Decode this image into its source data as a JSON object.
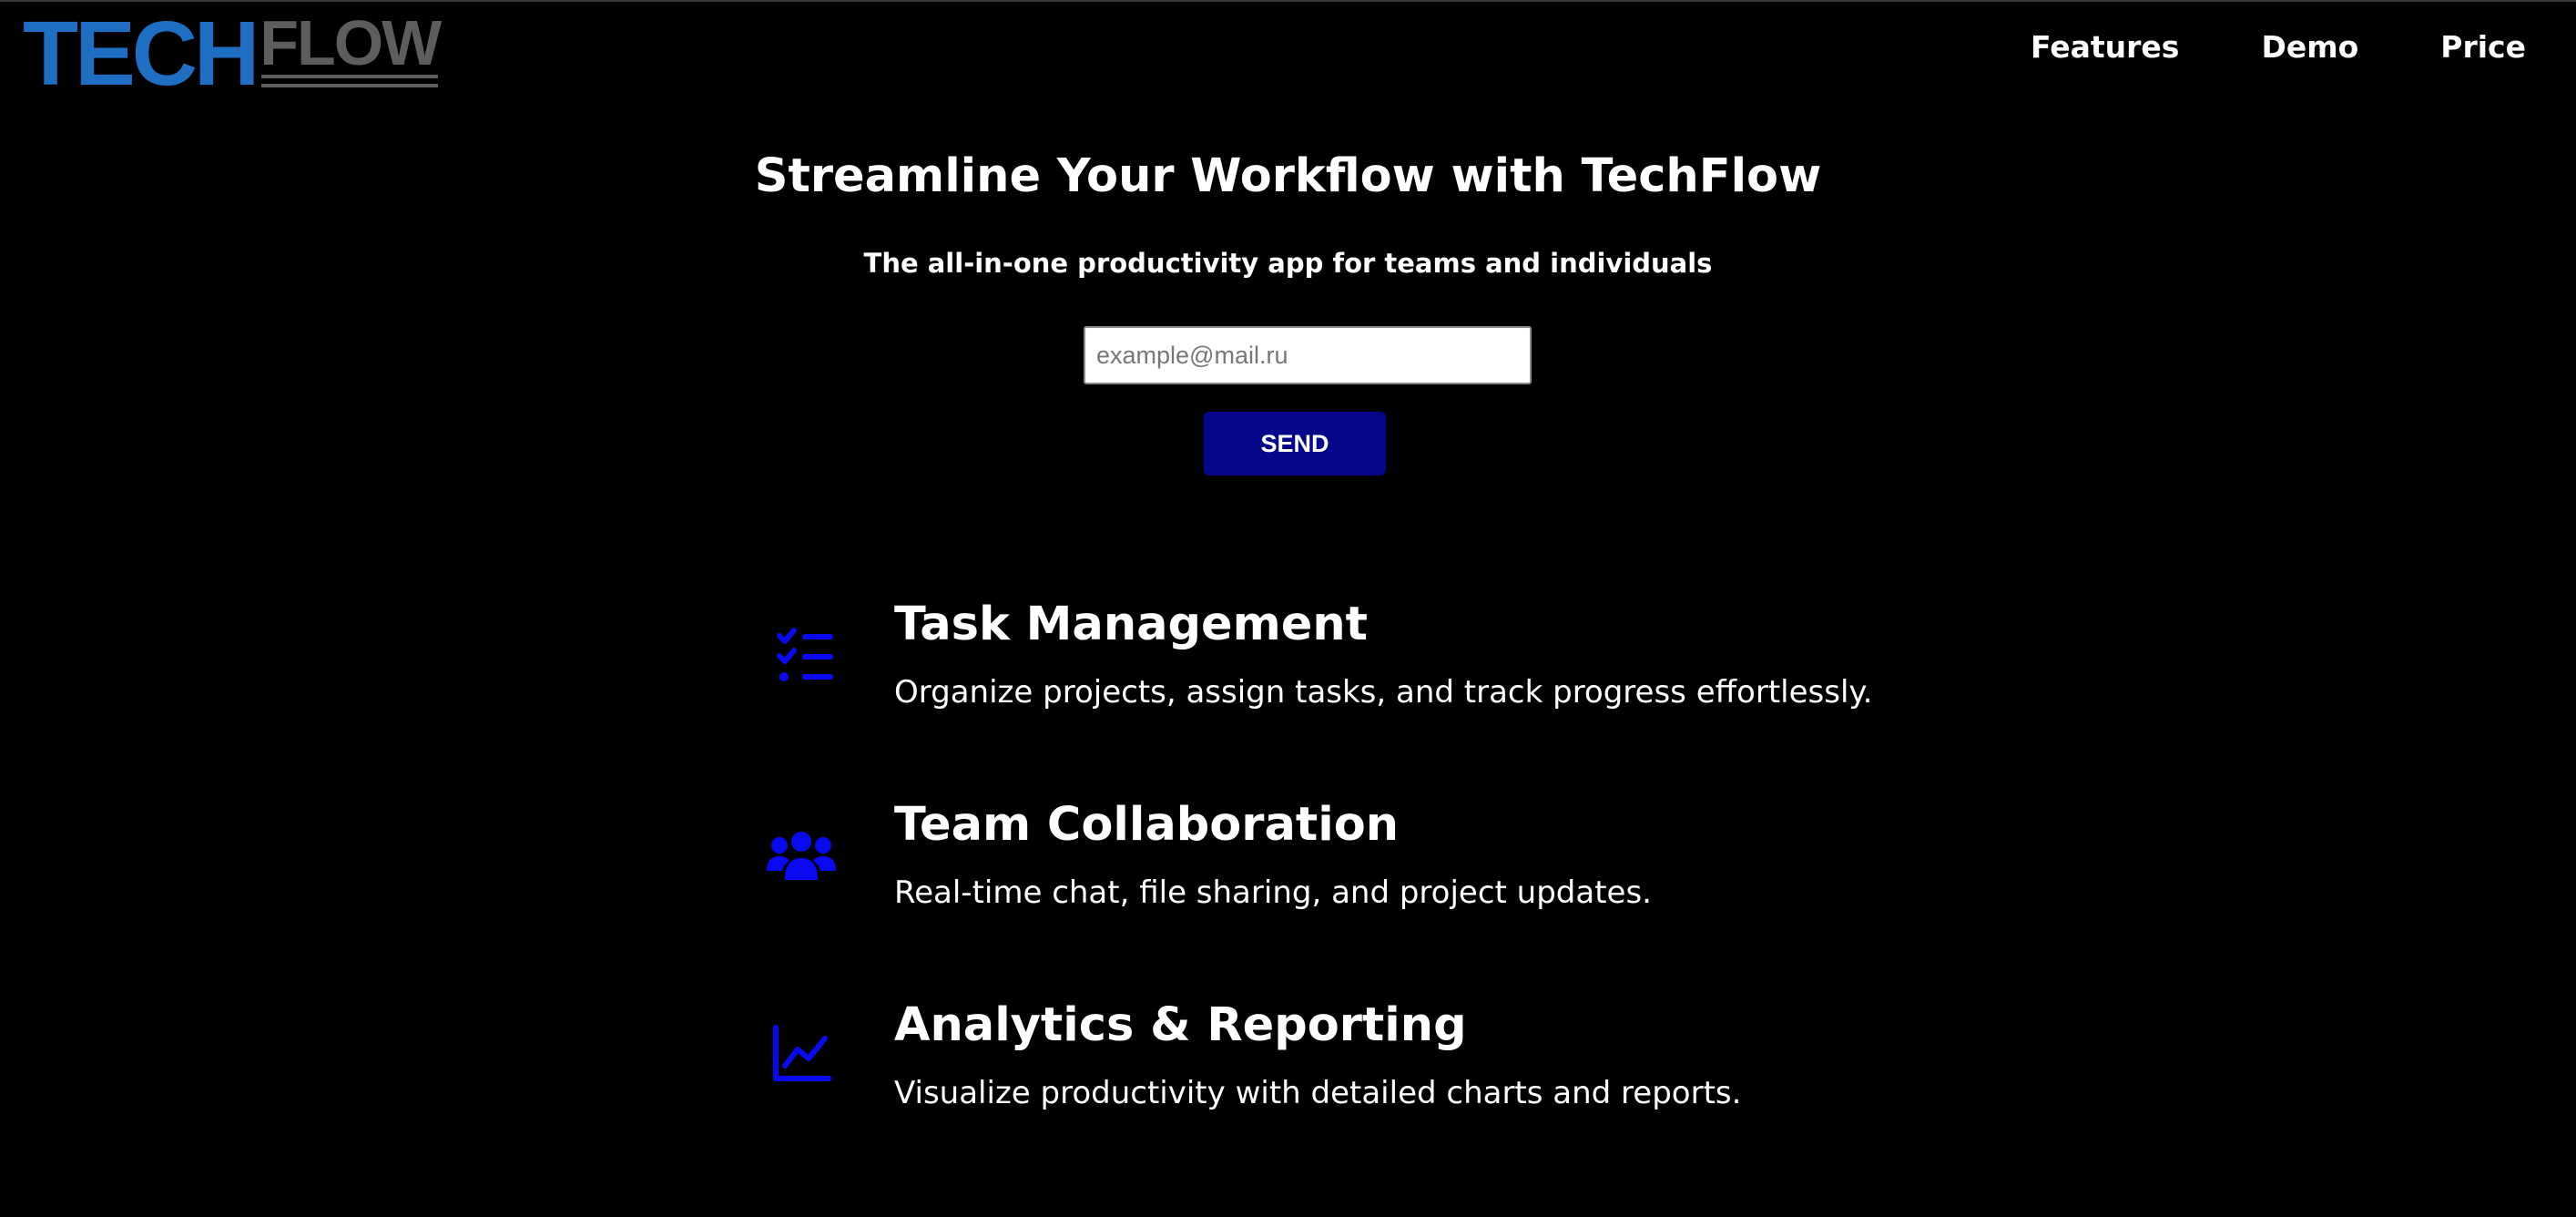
{
  "header": {
    "logo": {
      "part1": "TECH",
      "part2": "FLOW"
    },
    "nav": [
      {
        "label": "Features"
      },
      {
        "label": "Demo"
      },
      {
        "label": "Price"
      }
    ]
  },
  "hero": {
    "title": "Streamline Your Workflow with TechFlow",
    "subtitle": "The all-in-one productivity app for teams and individuals",
    "email_placeholder": "example@mail.ru",
    "send_label": "SEND"
  },
  "features": [
    {
      "icon": "task-list-icon",
      "title": "Task Management",
      "description": "Organize projects, assign tasks, and track progress effortlessly."
    },
    {
      "icon": "team-users-icon",
      "title": "Team Collaboration",
      "description": "Real-time chat, file sharing, and project updates."
    },
    {
      "icon": "line-chart-icon",
      "title": "Analytics & Reporting",
      "description": "Visualize productivity with detailed charts and reports."
    }
  ],
  "colors": {
    "background": "#000000",
    "accent_blue": "#1e6fc4",
    "button": "#06068a",
    "icon": "#0a0af0"
  }
}
